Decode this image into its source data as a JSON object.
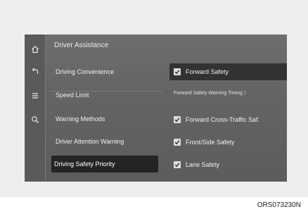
{
  "header": {
    "title": "Driver Assistance"
  },
  "rail": {
    "icons": [
      "home-icon",
      "back-icon",
      "menu-icon",
      "search-icon"
    ]
  },
  "menu": {
    "items": [
      {
        "label": "Driving Convenience",
        "selected": false
      },
      {
        "label": "Speed Limit",
        "selected": false
      },
      {
        "label": "Warning Methods",
        "selected": false
      },
      {
        "label": "Driver Attention Warning",
        "selected": false
      },
      {
        "label": "Driving Safety Priority",
        "selected": true
      }
    ]
  },
  "panel": {
    "forward_safety": {
      "label": "Forward Safety",
      "checked": true
    },
    "warning_timing_link": "Forward Safety Warning Timing 〉",
    "options": [
      {
        "label": "Forward Cross-Traffic Saf.",
        "checked": true
      },
      {
        "label": "Front/Side Safety",
        "checked": true
      },
      {
        "label": "Lane Safety",
        "checked": true
      }
    ]
  },
  "caption": "ORS073230N",
  "colors": {
    "screen_bg": "#646464",
    "selected_bg": "#242424",
    "text": "#f0f0f0",
    "checkbox": "#dcdcdc"
  }
}
